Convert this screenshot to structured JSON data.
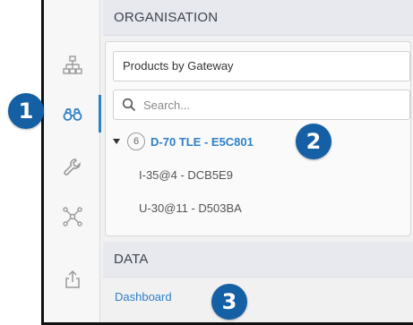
{
  "sidebar": {
    "items": [
      {
        "icon": "hierarchy-icon",
        "active": false
      },
      {
        "icon": "binoculars-icon",
        "active": true
      },
      {
        "icon": "wrench-icon",
        "active": false
      },
      {
        "icon": "network-icon",
        "active": false
      },
      {
        "icon": "share-icon",
        "active": false
      }
    ]
  },
  "organisation": {
    "heading": "ORGANISATION",
    "view_select": "Products by Gateway",
    "search_placeholder": "Search..."
  },
  "tree": {
    "gateway": {
      "count": "6",
      "name": "D-70 TLE - E5C801"
    },
    "children": [
      "I-35@4 - DCB5E9",
      "U-30@11 - D503BA"
    ]
  },
  "data": {
    "heading": "DATA",
    "dashboard_link": "Dashboard"
  },
  "callouts": [
    "1",
    "2",
    "3"
  ],
  "colors": {
    "accent": "#2f80c7",
    "callout": "#155fa5"
  }
}
